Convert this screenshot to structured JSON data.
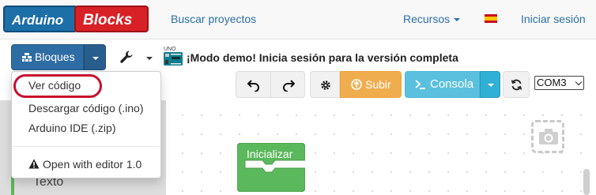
{
  "navbar": {
    "logo_left": "Arduino",
    "logo_right": "Blocks",
    "search_link": "Buscar proyectos",
    "resources_menu": "Recursos",
    "language_flag": "spain-flag-icon",
    "login_link": "Iniciar sesión"
  },
  "toolbar": {
    "blocks_button": "Bloques",
    "tools_icon": "wrench-icon",
    "board_icon": "arduino-uno-icon",
    "board_icon_text": "UNO",
    "demo_message": "¡Modo demo! Inicia sesión para la versión completa",
    "upload_button": "Subir",
    "console_button": "Consola",
    "port_select": {
      "selected": "COM3"
    }
  },
  "dropdown": {
    "items": [
      {
        "label": "Ver código",
        "highlighted": true
      },
      {
        "label": "Descargar código (.ino)"
      },
      {
        "label": "Arduino IDE (.zip)"
      },
      {
        "label": "Open with editor 1.0",
        "icon": "warning-icon"
      }
    ]
  },
  "workspace": {
    "category_visible": "Texto",
    "block_label": "Inicializar",
    "screenshot_icon": "camera-icon"
  },
  "colors": {
    "brand_blue": "#1d6fa8",
    "brand_red": "#d72127",
    "blocks_button": "#2e6da4",
    "upload_button": "#f0ad4e",
    "console_button": "#5bc0de",
    "init_block": "#5cb85c",
    "highlight_ring": "#c8102e"
  }
}
